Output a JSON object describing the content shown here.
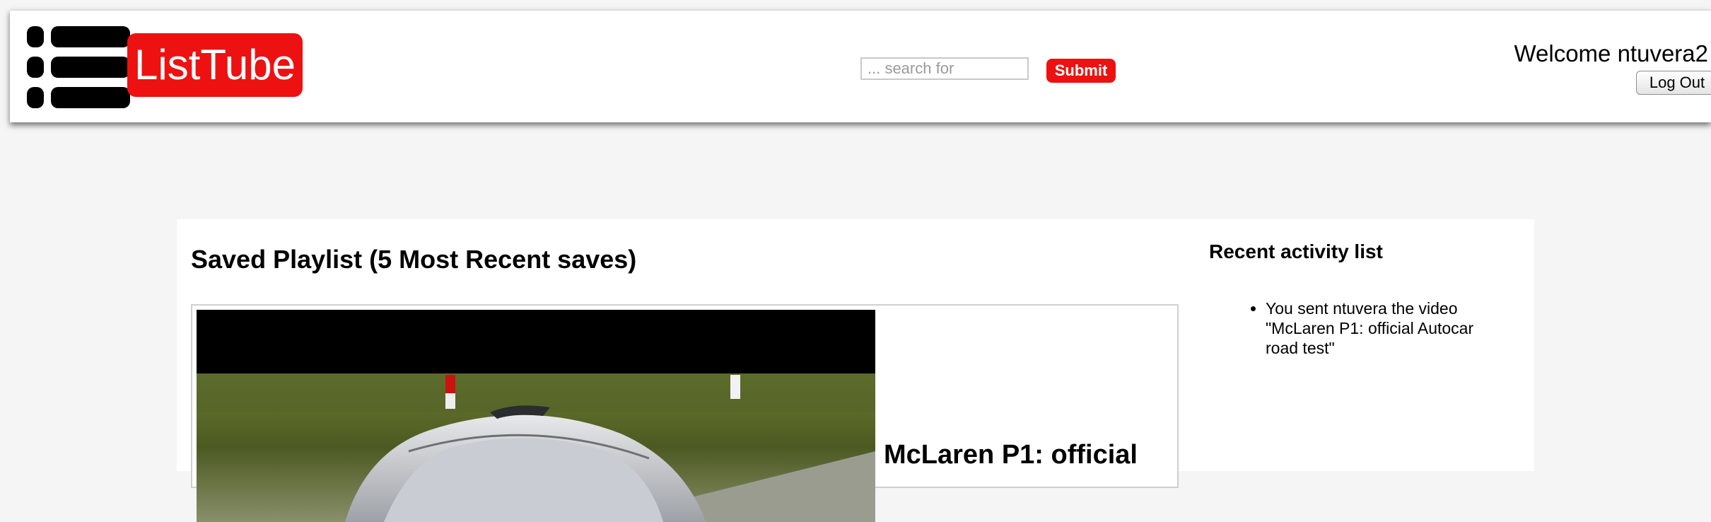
{
  "header": {
    "logo_text": "ListTube",
    "search": {
      "placeholder": "... search for",
      "value": ""
    },
    "submit_label": "Submit",
    "welcome_text": "Welcome ntuvera2",
    "logout_label": "Log Out"
  },
  "playlist": {
    "title": "Saved Playlist (5 Most Recent saves)",
    "items": [
      {
        "title": "McLaren P1: official"
      }
    ]
  },
  "activity": {
    "title": "Recent activity list",
    "items": [
      "You sent ntuvera the video \"McLaren P1: official Autocar road test\""
    ]
  },
  "colors": {
    "brand_red": "#ee1111",
    "page_background": "#f5f5f5"
  }
}
